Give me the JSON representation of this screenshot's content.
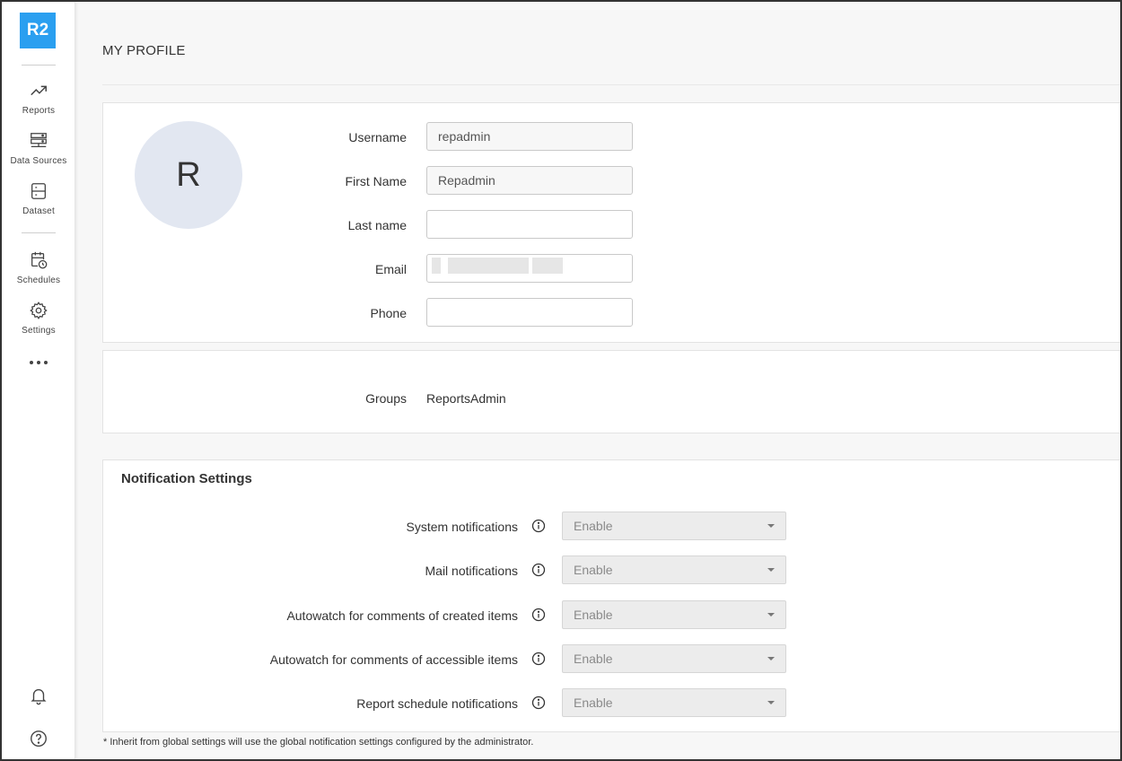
{
  "app": {
    "logo_text": "R2",
    "brand_color": "#2a9ff0"
  },
  "sidebar": {
    "items": [
      {
        "label": "Reports",
        "icon": "trend-chart-icon"
      },
      {
        "label": "Data Sources",
        "icon": "server-stack-icon"
      },
      {
        "label": "Dataset",
        "icon": "dataset-table-icon"
      },
      {
        "label": "Schedules",
        "icon": "calendar-clock-icon"
      },
      {
        "label": "Settings",
        "icon": "gear-icon"
      }
    ],
    "more_icon": "more-dots-icon",
    "bottom": [
      {
        "icon": "bell-icon"
      },
      {
        "icon": "help-icon"
      }
    ]
  },
  "page": {
    "title": "MY PROFILE"
  },
  "profile": {
    "avatar_letter": "R",
    "fields": {
      "username": {
        "label": "Username",
        "value": "repadmin"
      },
      "first_name": {
        "label": "First Name",
        "value": "Repadmin"
      },
      "last_name": {
        "label": "Last name",
        "value": ""
      },
      "email": {
        "label": "Email",
        "value": ""
      },
      "phone": {
        "label": "Phone",
        "value": ""
      }
    }
  },
  "groups": {
    "label": "Groups",
    "value": "ReportsAdmin"
  },
  "notifications": {
    "title": "Notification Settings",
    "items": [
      {
        "label": "System notifications",
        "value": "Enable"
      },
      {
        "label": "Mail notifications",
        "value": "Enable"
      },
      {
        "label": "Autowatch for comments of created items",
        "value": "Enable"
      },
      {
        "label": "Autowatch for comments of accessible items",
        "value": "Enable"
      },
      {
        "label": "Report schedule notifications",
        "value": "Enable"
      }
    ],
    "footnote": "* Inherit from global settings will use the global notification settings configured by the administrator."
  }
}
